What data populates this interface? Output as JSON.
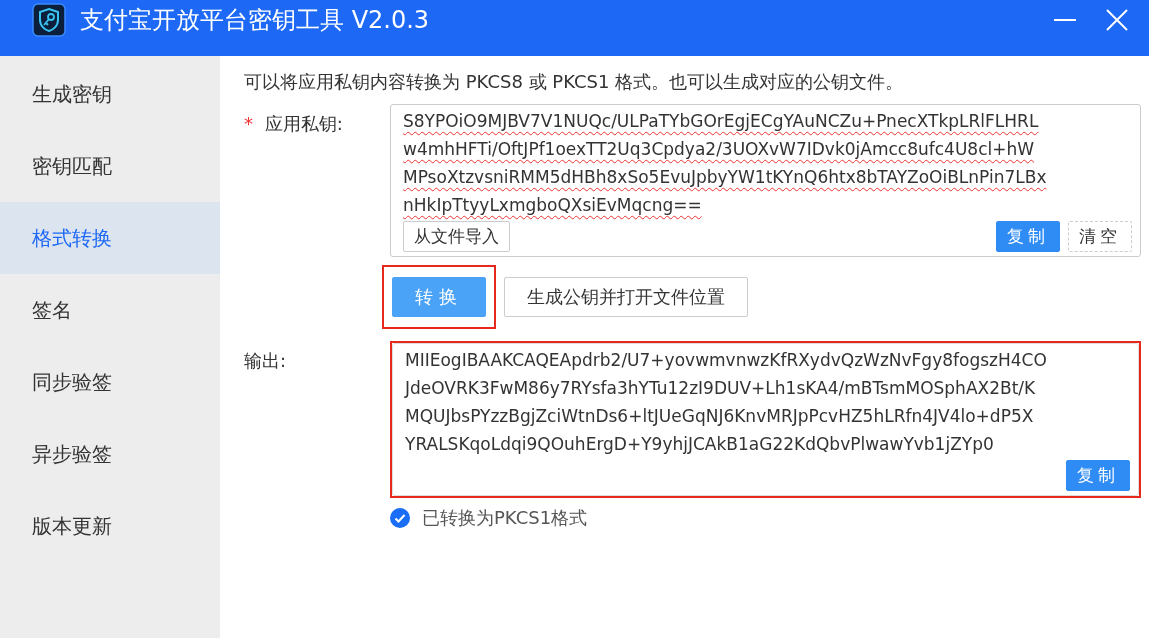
{
  "window": {
    "title": "支付宝开放平台密钥工具 V2.0.3"
  },
  "sidebar": {
    "items": [
      {
        "label": "生成密钥",
        "selected": false
      },
      {
        "label": "密钥匹配",
        "selected": false
      },
      {
        "label": "格式转换",
        "selected": true
      },
      {
        "label": "签名",
        "selected": false
      },
      {
        "label": "同步验签",
        "selected": false
      },
      {
        "label": "异步验签",
        "selected": false
      },
      {
        "label": "版本更新",
        "selected": false
      }
    ]
  },
  "description": "可以将应用私钥内容转换为 PKCS8 或 PKCS1 格式。也可以生成对应的公钥文件。",
  "private_key": {
    "label": "应用私钥:",
    "required": true,
    "required_marker": "*",
    "lines": [
      "S8YPOiO9MJBV7V1NUQc/ULPaTYbGOrEgjECgYAuNCZu+PnecXTkpLRlFLHRL",
      "w4mhHFTi/OftJPf1oexTT2Uq3Cpdya2/3UOXvW7IDvk0jAmcc8ufc4U8cl+hW",
      "MPsoXtzvsniRMM5dHBh8xSo5EvuJpbyYW1tKYnQ6htx8bTAYZoOiBLnPin7LBx",
      "nHkIpTtyyLxmgboQXsiEvMqcng=="
    ],
    "import_button": "从文件导入",
    "copy_button": "复制",
    "clear_button": "清空"
  },
  "actions": [
    {
      "label": "转换",
      "kind": "primary",
      "highlighted": true
    },
    {
      "label": "生成公钥并打开文件位置",
      "kind": "default",
      "highlighted": false
    }
  ],
  "output": {
    "label": "输出:",
    "highlighted": true,
    "lines": [
      "MIIEogIBAAKCAQEApdrb2/U7+yovwmvnwzKfRXydvQzWzNvFgy8fogszH4CO",
      "JdeOVRK3FwM86y7RYsfa3hYTu12zI9DUV+Lh1sKA4/mBTsmMOSphAX2Bt/K",
      "MQUJbsPYzzBgjZciWtnDs6+ltJUeGqNJ6KnvMRJpPcvHZ5hLRfn4JV4lo+dP5X",
      "YRALSKqoLdqi9QOuhErgD+Y9yhjJCAkB1aG22KdQbvPlwawYvb1jZYp0"
    ],
    "copy_button": "复制"
  },
  "status": {
    "text": "已转换为PKCS1格式",
    "checked": true
  }
}
